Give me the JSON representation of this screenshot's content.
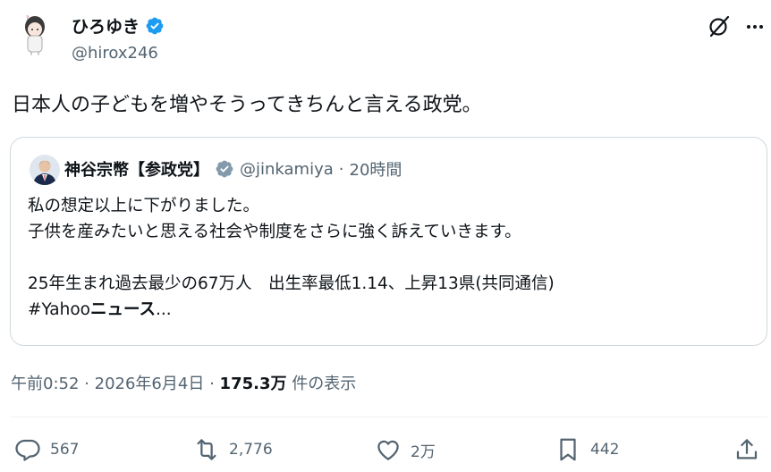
{
  "author": {
    "display_name": "ひろゆき",
    "handle": "@hirox246",
    "verified": true,
    "avatar_icon": "avatar-cartoon-icon"
  },
  "post": {
    "text": "日本人の子どもを増やそうってきちんと言える政党。"
  },
  "quote": {
    "display_name": "神谷宗幣【参政党】",
    "handle": "@jinkamiya",
    "separator": "·",
    "time": "20時間",
    "lines": [
      "私の想定以上に下がりました。",
      "子供を産みたいと思える社会や制度をさらに強く訴えていきます。",
      "",
      "25年生まれ過去最少の67万人　出生率最低1.14、上昇13県(共同通信)"
    ],
    "hashtag_prefix": "#Yahoo",
    "hashtag_bold": "ニュース",
    "hashtag_suffix": "..."
  },
  "meta": {
    "time": "午前0:52",
    "sep1": "·",
    "date": "2026年6月4日",
    "sep2": "·",
    "views_count": "175.3万",
    "views_label": "件の表示"
  },
  "actions": {
    "replies": "567",
    "reposts": "2,776",
    "likes": "2万",
    "bookmarks": "442"
  },
  "colors": {
    "verified_blue": "#1d9bf0",
    "verified_gray": "#829aab",
    "text_primary": "#0f1419",
    "text_secondary": "#536471",
    "border": "#cfd9de"
  }
}
